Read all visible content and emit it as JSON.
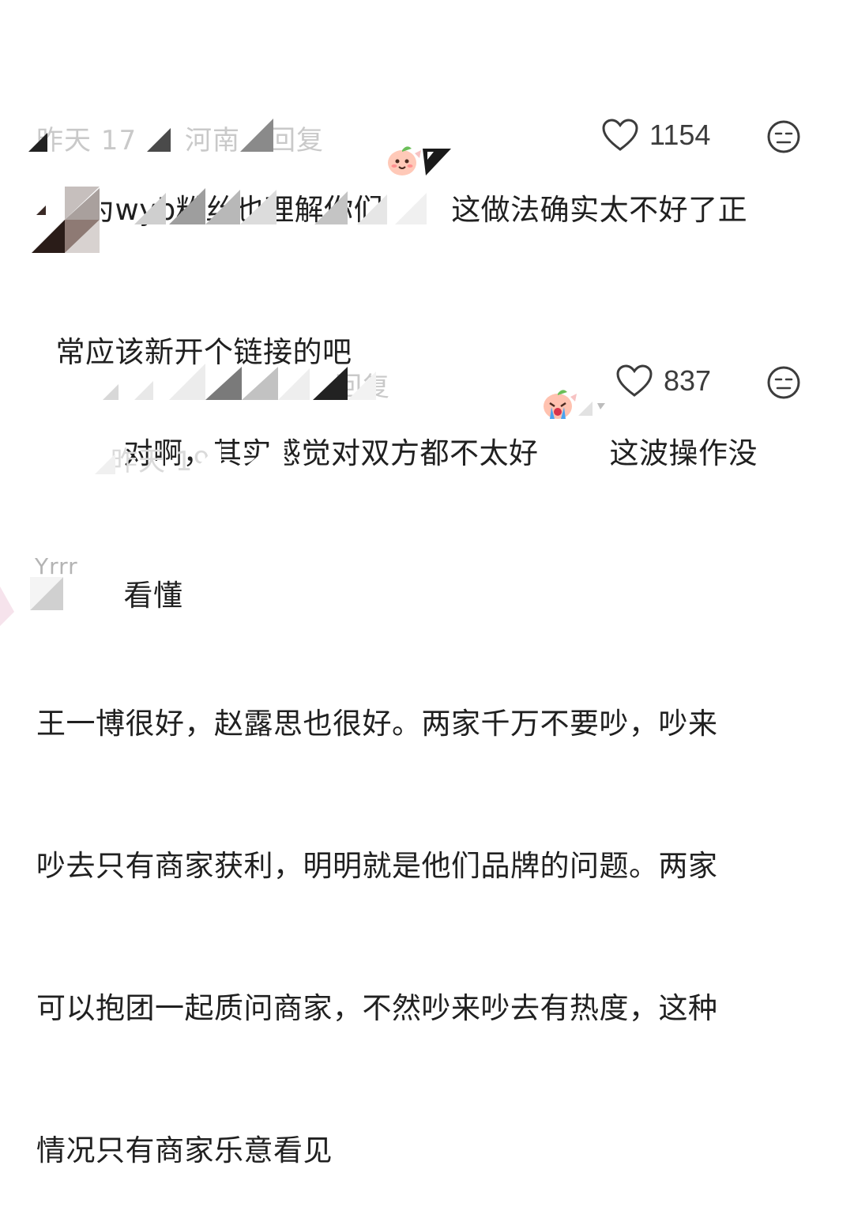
{
  "comments": [
    {
      "text_line1": "作为wyb粉丝也理解你们",
      "text_line1_after": "这做法确实太不好了正",
      "text_line2": "常应该新开个链接的吧",
      "meta_fragments": [
        "昨天 17",
        "河南",
        "回复"
      ],
      "likes": "1154",
      "emoji": "peach-smile-icon"
    },
    {
      "text_line1": "对啊，其实感觉对双方都不太好",
      "text_line1_after": "这波操作没",
      "text_line2": "看懂",
      "meta_fragments": [
        "回复"
      ],
      "likes": "837",
      "emoji": "peach-cry-icon"
    },
    {
      "text_lines": [
        "王一博很好，赵露思也很好。两家千万不要吵，吵来",
        "吵去只有商家获利，明明就是他们品牌的问题。两家",
        "可以抱团一起质问商家，不然吵来吵去有热度，这种",
        "情况只有商家乐意看见"
      ]
    }
  ],
  "collapsed_thread_text": "昨天 19",
  "username_fragment": "Yrrr",
  "colors": {
    "text": "#202020",
    "meta": "#c9c9c9",
    "icon": "#3c3c3c"
  }
}
